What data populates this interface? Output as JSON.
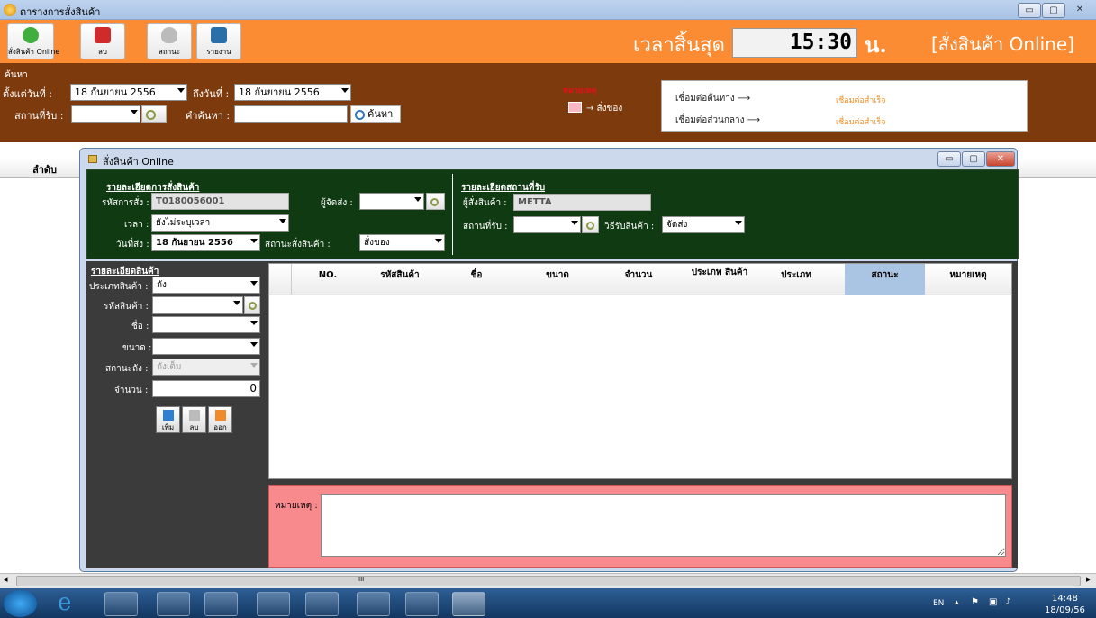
{
  "window": {
    "title": "ตารางการสั่งสินค้า",
    "min": "▭",
    "max": "▢",
    "close": "✕"
  },
  "toolbar": {
    "buttons": [
      {
        "label": "สั่งสินค้า Online",
        "icon": "plus-icon",
        "color": "#3fae3f"
      },
      {
        "label": "ลบ",
        "icon": "trash-icon",
        "color": "#d12a2a"
      },
      {
        "label": "สถานะ",
        "icon": "shield-icon",
        "color": "#9a9a9a"
      },
      {
        "label": "รายงาน",
        "icon": "report-icon",
        "color": "#2b6fa8"
      }
    ],
    "clock_label": "เวลาสิ้นสุด :",
    "clock_value": "15:30",
    "clock_unit": "น.",
    "mode": "[สั่งสินค้า Online]"
  },
  "search": {
    "legend": "ค้นหา",
    "from_label": "ตั้งแต่วันที่ :",
    "from_value": "18 กันยายน   2556",
    "to_label": "ถึงวันที่ :",
    "to_value": "18 กันยายน   2556",
    "place_label": "สถานที่รับ :",
    "keyword_label": "คำค้นหา :",
    "search_button": "ค้นหา"
  },
  "legend": {
    "red_title": "หมายเหตุ",
    "box_text": "→ สั่งของ"
  },
  "info": {
    "line1": "เชื่อมต่อต้นทาง  ⟶",
    "line1_status": "เชื่อมต่อสำเร็จ",
    "line2": "เชื่อมต่อส่วนกลาง  ⟶",
    "line2_status": "เชื่อมต่อสำเร็จ"
  },
  "list": {
    "col_no": "ลำดับ"
  },
  "dialog": {
    "title": "สั่งสินค้า Online",
    "order_group": "รายละเอียดการสั่งสินค้า",
    "order_no_label": "รหัสการสั่ง :",
    "order_no": "T0180056001",
    "time_label": "เวลา :",
    "time_value": "ยังไม่ระบุเวลา",
    "date_label": "วันที่ส่ง :",
    "date_value": "18  กันยายน   2556",
    "sender_label": "ผู้จัดส่ง :",
    "order_status_label": "สถานะสั่งสินค้า :",
    "order_status_value": "สั่งของ",
    "receive_group": "รายละเอียดสถานที่รับ",
    "orderer_label": "ผู้สั่งสินค้า :",
    "orderer_value": "METTA",
    "place_label": "สถานที่รับ :",
    "method_label": "วิธีรับสินค้า :",
    "method_value": "จัดส่ง",
    "product_group": "รายละเอียดสินค้า",
    "type_label": "ประเภทสินค้า :",
    "type_value": "ถัง",
    "code_label": "รหัสสินค้า :",
    "name_label": "ชื่อ :",
    "size_label": "ขนาด :",
    "tank_status_label": "สถานะถัง :",
    "tank_status_value": "ถังเต็ม",
    "qty_label": "จำนวน :",
    "qty_value": "0",
    "btn_add": "เพิ่ม",
    "btn_delete": "ลบ",
    "btn_exit": "ออก",
    "grid_headers": [
      "NO.",
      "รหัสสินค้า",
      "ชื่อ",
      "ขนาด",
      "จำนวน",
      "ประเภท สินค้า",
      "ประเภท",
      "สถานะ",
      "หมายเหตุ"
    ],
    "note_label": "หมายเหตุ :"
  },
  "scroll": {
    "grip": "III"
  },
  "taskbar": {
    "lang": "EN",
    "time": "14:48",
    "date": "18/09/56"
  }
}
